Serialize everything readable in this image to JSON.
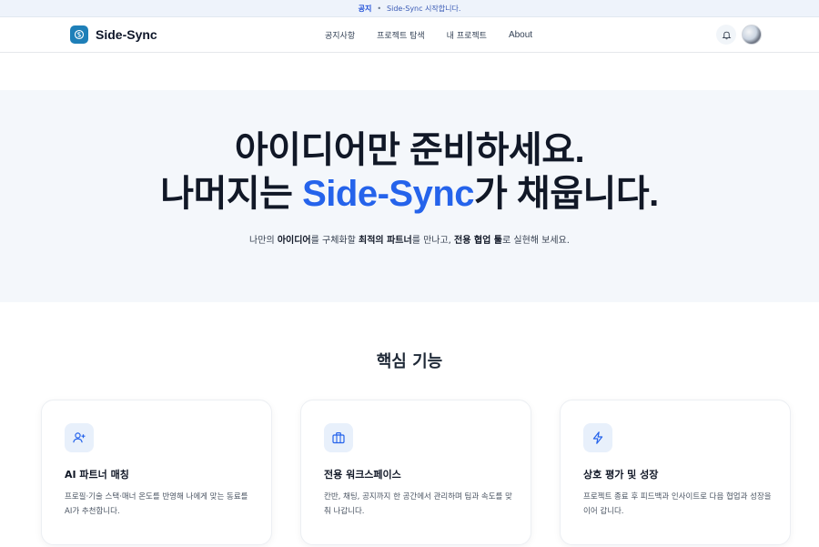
{
  "announcement": {
    "tag": "공지",
    "separator": "•",
    "text": "Side-Sync 시작합니다."
  },
  "header": {
    "brand": "Side-Sync",
    "nav": [
      "공지사항",
      "프로젝트 탐색",
      "내 프로젝트",
      "About"
    ]
  },
  "hero": {
    "line1": "아이디어만 준비하세요.",
    "line2_prefix": "나머지는 ",
    "line2_accent": "Side-Sync",
    "line2_suffix": "가 채웁니다.",
    "sub": {
      "p1": "나만의 ",
      "b1": "아이디어",
      "p2": "를 구체화할 ",
      "b2": "최적의 파트너",
      "p3": "를 만나고, ",
      "b3": "전용 협업 툴",
      "p4": "로 실현해 보세요."
    }
  },
  "features": {
    "title": "핵심 기능",
    "cards": [
      {
        "icon": "user-plus-icon",
        "title": "AI 파트너 매칭",
        "desc": "프로필·기술 스택·매너 온도를 반영해 나에게 맞는 동료를 AI가 추천합니다."
      },
      {
        "icon": "briefcase-icon",
        "title": "전용 워크스페이스",
        "desc": "칸반, 채팅, 공지까지 한 공간에서 관리하며 팀과 속도를 맞춰 나갑니다."
      },
      {
        "icon": "lightning-icon",
        "title": "상호 평가 및 성장",
        "desc": "프로젝트 종료 후 피드백과 인사이트로 다음 협업과 성장을 이어 갑니다."
      }
    ]
  },
  "colors": {
    "accent": "#2563eb",
    "brand": "#1e7fb8",
    "hero_bg": "#f4f7fb"
  }
}
